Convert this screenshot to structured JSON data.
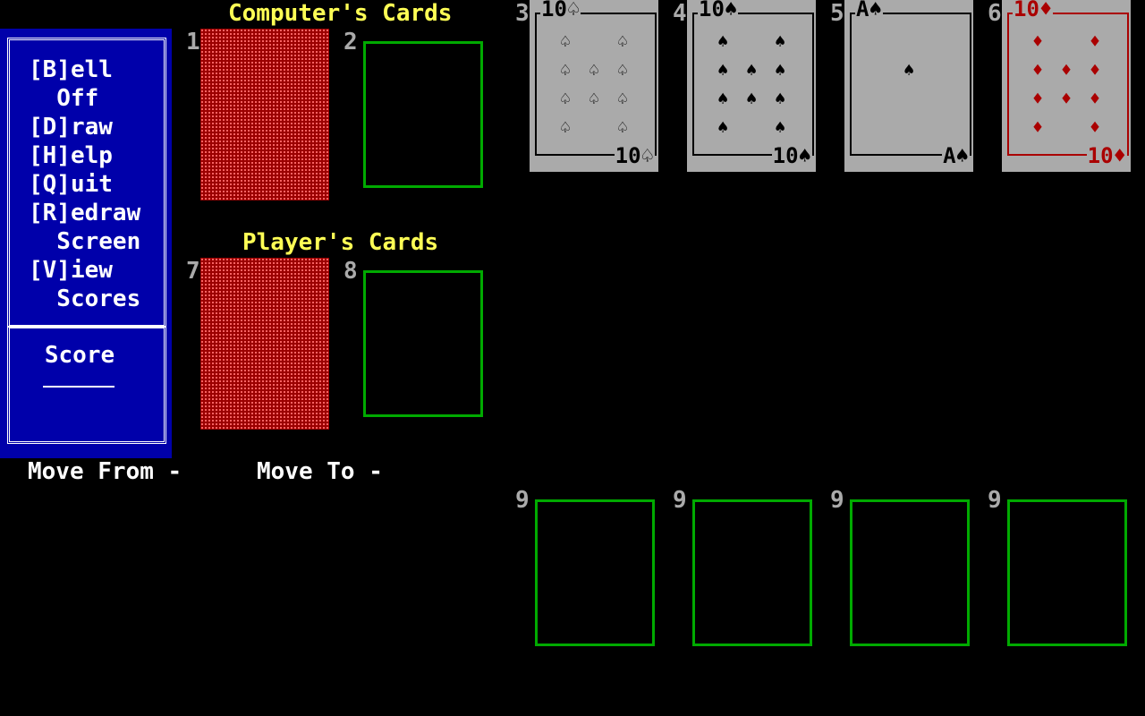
{
  "menu": {
    "items": [
      "[B]ell",
      "  Off",
      "[D]raw",
      "[H]elp",
      "[Q]uit",
      "[R]edraw",
      "  Screen",
      "[V]iew",
      "  Scores"
    ],
    "score_label": "Score"
  },
  "headings": {
    "computer": "Computer's Cards",
    "player": "Player's Cards"
  },
  "pile_numbers": {
    "p1": "1",
    "p2": "2",
    "p3": "3",
    "p4": "4",
    "p5": "5",
    "p6": "6",
    "p7": "7",
    "p8": "8",
    "p9a": "9",
    "p9b": "9",
    "p9c": "9",
    "p9d": "9"
  },
  "cards": [
    {
      "rank": "10",
      "suit": "♤",
      "suit_name": "spade-outline",
      "color": "#000000",
      "pip_count": 10
    },
    {
      "rank": "10",
      "suit": "♠",
      "suit_name": "spade",
      "color": "#000000",
      "pip_count": 10
    },
    {
      "rank": "A",
      "suit": "♠",
      "suit_name": "spade",
      "color": "#000000",
      "pip_count": 1
    },
    {
      "rank": "10",
      "suit": "♦",
      "suit_name": "diamond",
      "color": "#aa0000",
      "pip_count": 10
    }
  ],
  "status": {
    "move_from": "Move From -",
    "move_to": "Move To -"
  },
  "colors": {
    "menu_bg": "#0000aa",
    "heading": "#ffff55",
    "slot_border": "#00aa00",
    "deck_back": "#9b0000",
    "card_face": "#aaaaaa"
  }
}
